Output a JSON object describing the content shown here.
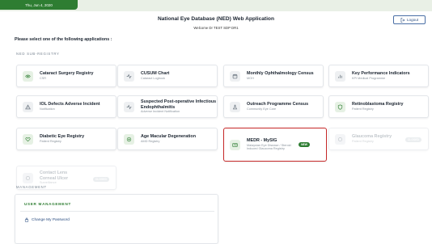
{
  "header": {
    "date": "Thu, Jun 4, 2020",
    "title": "National Eye Database (NED) Web Application",
    "welcome": "Welcome Dr TEST SDP DR1",
    "logout_label": "Logout"
  },
  "prompt": "Please select one of the following applications :",
  "sections": {
    "registry_label": "NED SUB-REGISTRY",
    "management_label": "MANAGEMENT"
  },
  "cards": [
    {
      "title": "Cataract Surgery Registry",
      "subtitle": "CSR",
      "icon": "eye-icon"
    },
    {
      "title": "CUSUM Chart",
      "subtitle": "Cataract Logbook",
      "icon": "pulse-icon"
    },
    {
      "title": "Monthly Ophthalmology Census",
      "subtitle": "MOH",
      "icon": "calendar-icon"
    },
    {
      "title": "Key Performance Indicators",
      "subtitle": "KPI Medical Programme",
      "icon": "bar-chart-icon"
    },
    {
      "title": "IOL Defects Adverse Incident",
      "subtitle": "Notification",
      "icon": "warning-icon"
    },
    {
      "title": "Suspected Post-operative Infectious Endophthalmitis",
      "subtitle": "Adverse Incident Notification",
      "icon": "pulse-icon"
    },
    {
      "title": "Outreach Programme Census",
      "subtitle": "Community Eye Care",
      "icon": "flask-icon"
    },
    {
      "title": "Retinoblastoma Registry",
      "subtitle": "Patient Registry",
      "icon": "shield-icon"
    },
    {
      "title": "Diabetic Eye Registry",
      "subtitle": "Patient Registry",
      "icon": "heart-icon"
    },
    {
      "title": "Age Macular Degeneration",
      "subtitle": "AMD Registry",
      "icon": "target-icon"
    },
    {
      "title": "MEDR - MySIG",
      "subtitle": "Malaysian Eye Disease / Steroid Induced Glaucoma Registry",
      "icon": "id-card-icon",
      "badge": "NEW"
    },
    {
      "title": "Glaucoma Registry",
      "subtitle": "Patient Registry",
      "icon": "circle-icon",
      "badge": "CLOSED"
    },
    {
      "title": "Contact Lens Corneal Ulcer",
      "subtitle": "Surveillance",
      "icon": "circle-icon",
      "badge": "CLOSED"
    }
  ],
  "management": {
    "title": "USER MANAGEMENT",
    "link": "Change My Password"
  },
  "colors": {
    "accent": "#2e7d32",
    "highlight_border": "#c62828",
    "link": "#2c4f82"
  }
}
